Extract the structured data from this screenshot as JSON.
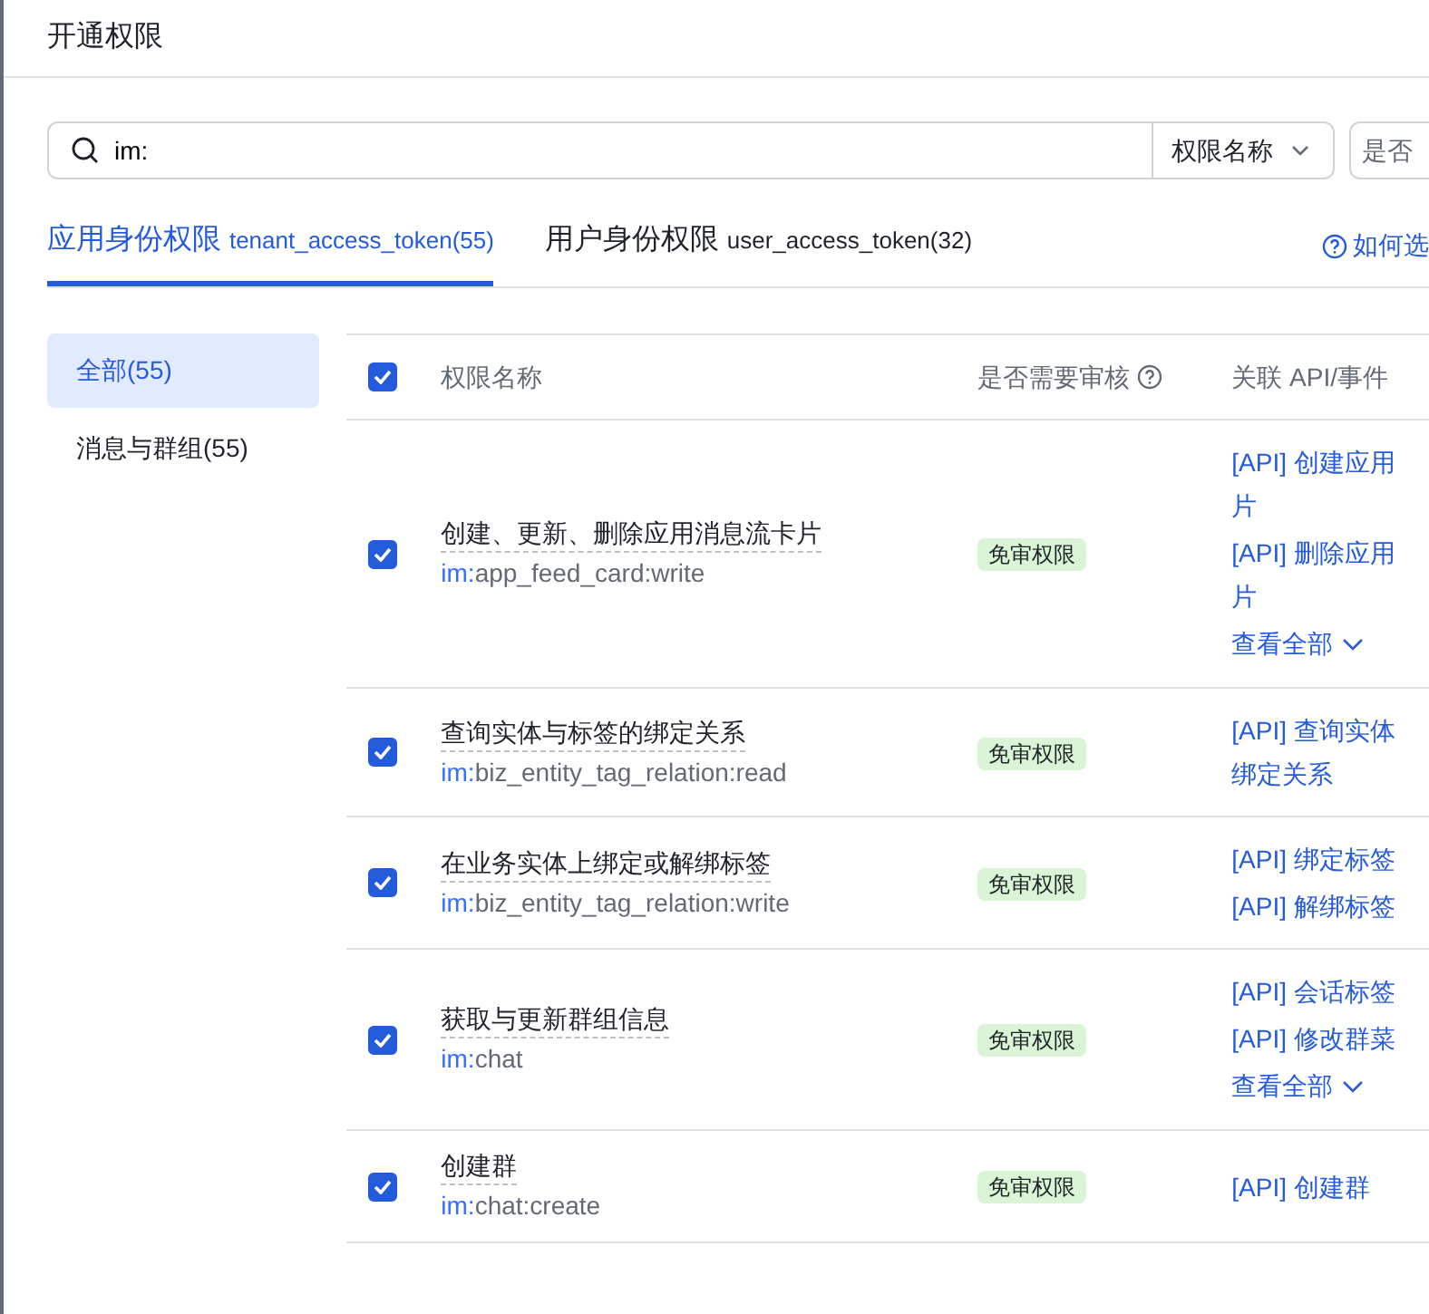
{
  "title": "开通权限",
  "search": {
    "value": "im:",
    "field_select": "权限名称",
    "second_select": "是否"
  },
  "tabs": [
    {
      "label": "应用身份权限",
      "token": "tenant_access_token(55)",
      "selected": true
    },
    {
      "label": "用户身份权限",
      "token": "user_access_token(32)",
      "selected": false
    }
  ],
  "help_link": "如何选",
  "sidebar": [
    {
      "label": "全部(55)",
      "selected": true
    },
    {
      "label": "消息与群组(55)",
      "selected": false
    }
  ],
  "table": {
    "all_checked": true,
    "columns": [
      "权限名称",
      "是否需要审核",
      "关联 API/事件"
    ],
    "rows": [
      {
        "checked": true,
        "name": "创建、更新、删除应用消息流卡片",
        "scope_prefix": "im:",
        "scope_rest": "app_feed_card:write",
        "review": "免审权限",
        "apis": [
          [
            "[API] 创建应用",
            "片"
          ],
          [
            "[API] 删除应用",
            "片"
          ]
        ],
        "more": "查看全部"
      },
      {
        "checked": true,
        "name": "查询实体与标签的绑定关系",
        "scope_prefix": "im:",
        "scope_rest": "biz_entity_tag_relation:read",
        "review": "免审权限",
        "apis": [
          [
            "[API] 查询实体",
            "绑定关系"
          ]
        ]
      },
      {
        "checked": true,
        "name": "在业务实体上绑定或解绑标签",
        "scope_prefix": "im:",
        "scope_rest": "biz_entity_tag_relation:write",
        "review": "免审权限",
        "apis": [
          [
            "[API] 绑定标签"
          ],
          [
            "[API] 解绑标签"
          ]
        ]
      },
      {
        "checked": true,
        "name": "获取与更新群组信息",
        "scope_prefix": "im:",
        "scope_rest": "chat",
        "review": "免审权限",
        "apis": [
          [
            "[API] 会话标签"
          ],
          [
            "[API] 修改群菜"
          ]
        ],
        "more": "查看全部"
      },
      {
        "checked": true,
        "name": "创建群",
        "scope_prefix": "im:",
        "scope_rest": "chat:create",
        "review": "免审权限",
        "apis": [
          [
            "[API] 创建群"
          ]
        ]
      }
    ]
  }
}
